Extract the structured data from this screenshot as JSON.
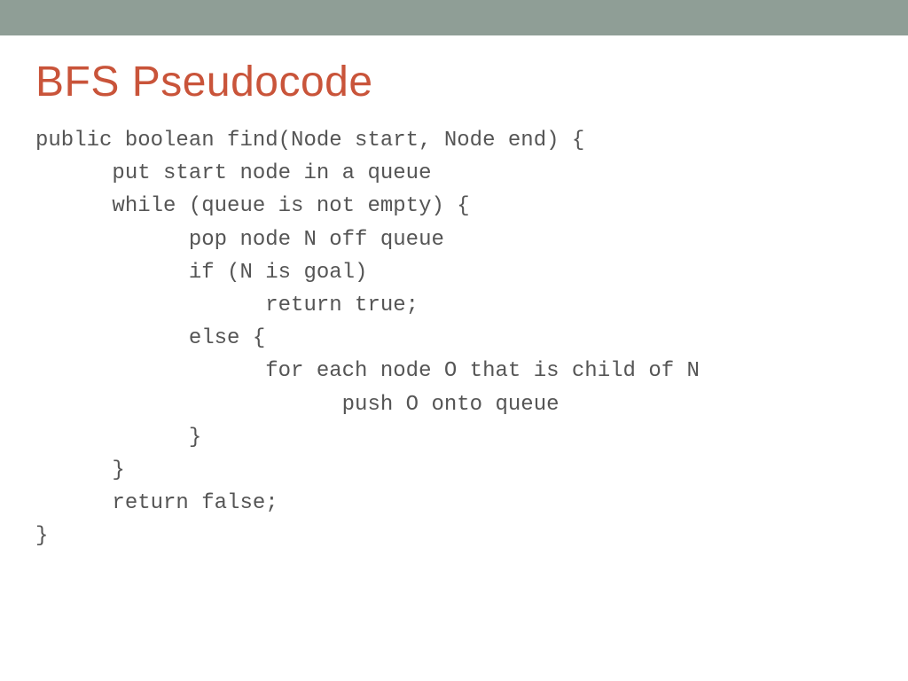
{
  "slide": {
    "title": "BFS Pseudocode",
    "code_lines": [
      "public boolean find(Node start, Node end) {",
      "      put start node in a queue",
      "      while (queue is not empty) {",
      "            pop node N off queue",
      "            if (N is goal)",
      "                  return true;",
      "            else {",
      "                  for each node O that is child of N",
      "                        push O onto queue",
      "            }",
      "      }",
      "      return false;",
      "}"
    ]
  },
  "colors": {
    "top_bar": "#8f9e96",
    "title": "#c9543a",
    "code_text": "#555555"
  }
}
